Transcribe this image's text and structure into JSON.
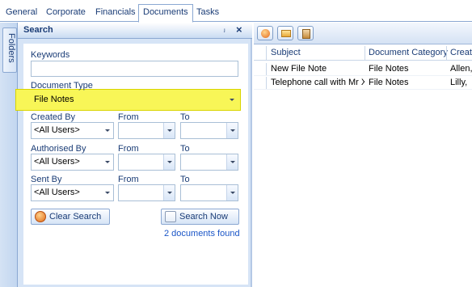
{
  "tabs": [
    "General",
    "Corporate",
    "Financials",
    "Documents",
    "Tasks"
  ],
  "side_rail": {
    "label": "Folders"
  },
  "search_panel": {
    "title": "Search",
    "pin_glyph": "ⱼ",
    "close_glyph": "×",
    "keywords_label": "Keywords",
    "keywords_value": "",
    "document_type_label": "Document Type",
    "document_type_value": "File Notes",
    "from_label": "From",
    "to_label": "To",
    "created_by_label": "Created By",
    "created_by_value": "<All Users>",
    "authorised_by_label": "Authorised By",
    "authorised_by_value": "<All Users>",
    "sent_by_label": "Sent By",
    "sent_by_value": "<All Users>",
    "clear_search_label": "Clear Search",
    "search_now_label": "Search Now",
    "status_text": "2 documents found"
  },
  "results": {
    "columns": [
      "Subject",
      "Document Category",
      "Creat"
    ],
    "rows": [
      [
        "New File Note",
        "File Notes",
        "Allen,"
      ],
      [
        "Telephone call with Mr X",
        "File Notes",
        "Lilly, "
      ]
    ]
  },
  "colors": {
    "highlight": "#f8f657",
    "accent": "#1a3c76",
    "link": "#1a55c7"
  },
  "icons": [
    "pin-icon",
    "close-icon",
    "dropdown-arrow-icon",
    "clear-search-icon",
    "search-now-icon",
    "add-icon",
    "folder-open-icon",
    "paste-icon"
  ]
}
